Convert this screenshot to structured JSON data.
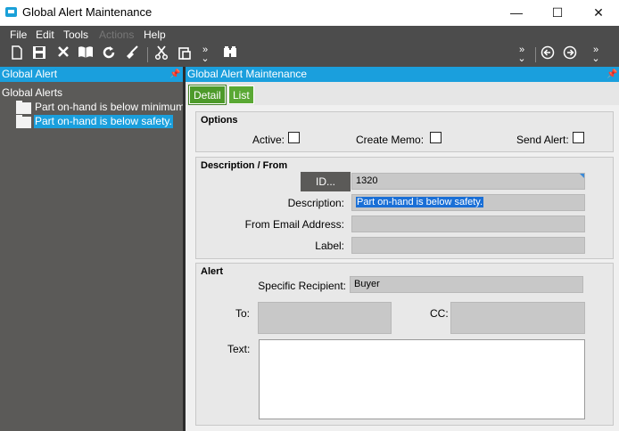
{
  "window": {
    "title": "Global Alert Maintenance",
    "minimize": "—",
    "maximize": "☐",
    "close": "✕"
  },
  "menu": [
    "File",
    "Edit",
    "Tools",
    "Actions",
    "Help"
  ],
  "toolbar": {
    "left_icons": [
      "new-icon",
      "save-icon",
      "delete-icon",
      "open-book-icon",
      "refresh-icon",
      "clear-icon",
      "cut-icon",
      "paste-icon",
      "more-icon",
      "binoculars-icon"
    ],
    "right_icons": [
      "more-icon",
      "more-icon",
      "previous-icon",
      "next-icon",
      "more-icon"
    ]
  },
  "left_panel": {
    "header": "Global Alert",
    "tree": {
      "root": "Global Alerts",
      "items": [
        {
          "label": "Part on-hand is below minimum.",
          "selected": false
        },
        {
          "label": "Part on-hand is below safety.",
          "selected": true
        }
      ]
    }
  },
  "right_panel": {
    "header": "Global Alert Maintenance",
    "tabs": [
      {
        "label": "Detail",
        "active": true
      },
      {
        "label": "List",
        "active": false
      }
    ]
  },
  "options": {
    "title": "Options",
    "active_label": "Active:",
    "active_checked": false,
    "create_memo_label": "Create Memo:",
    "create_memo_checked": false,
    "send_alert_label": "Send Alert:",
    "send_alert_checked": false
  },
  "description": {
    "title": "Description / From",
    "id_button": "ID...",
    "id_value": "1320",
    "description_label": "Description:",
    "description_value": "Part on-hand is below safety.",
    "from_email_label": "From Email Address:",
    "from_email_value": "",
    "label_label": "Label:",
    "label_value": ""
  },
  "alert": {
    "title": "Alert",
    "recipient_label": "Specific Recipient:",
    "recipient_value": "Buyer",
    "to_label": "To:",
    "to_value": "",
    "cc_label": "CC:",
    "cc_value": "",
    "text_label": "Text:",
    "text_value": ""
  },
  "colors": {
    "accent": "#1a9fdd",
    "tab_green": "#5aa834",
    "dark_gray": "#4c4c4c",
    "panel_gray": "#5b5a58"
  }
}
